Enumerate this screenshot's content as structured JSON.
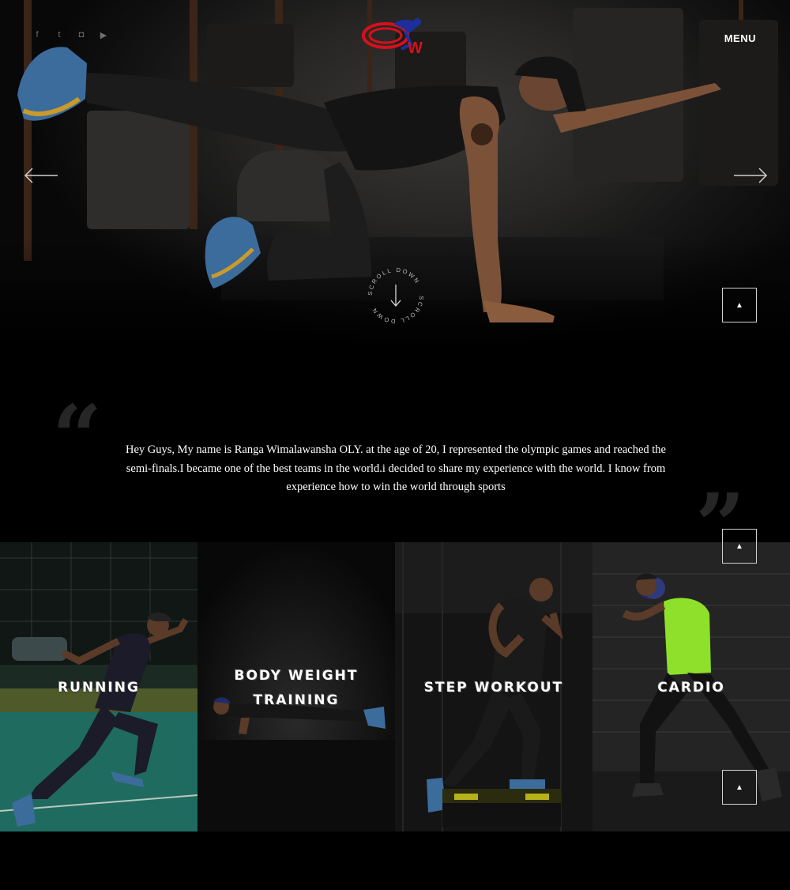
{
  "header": {
    "menu_label": "MENU",
    "social": [
      {
        "icon": "facebook-icon",
        "glyph": "f"
      },
      {
        "icon": "twitter-icon",
        "glyph": "t"
      },
      {
        "icon": "instagram-icon",
        "glyph": "◘"
      },
      {
        "icon": "youtube-icon",
        "glyph": "▶"
      }
    ],
    "logo_letter": "W"
  },
  "hero": {
    "scroll_label": "SCROLL DOWN"
  },
  "quote": {
    "text": "Hey Guys, My name is Ranga Wimalawansha OLY. at the age of 20, I represented the olympic games and reached the semi-finals.I became one of the best teams in the world.i decided to share my experience with the world. I know from experience how to win the world through sports"
  },
  "programs": [
    {
      "title": "RUNNING"
    },
    {
      "title": "BODY WEIGHT TRAINING"
    },
    {
      "title": "STEP WORKOUT"
    },
    {
      "title": "CARDIO"
    }
  ],
  "colors": {
    "accent_red": "#d4111c",
    "accent_blue": "#1e2f9c",
    "cardio_vest": "#8ee02a",
    "turf": "#1f6b60"
  }
}
